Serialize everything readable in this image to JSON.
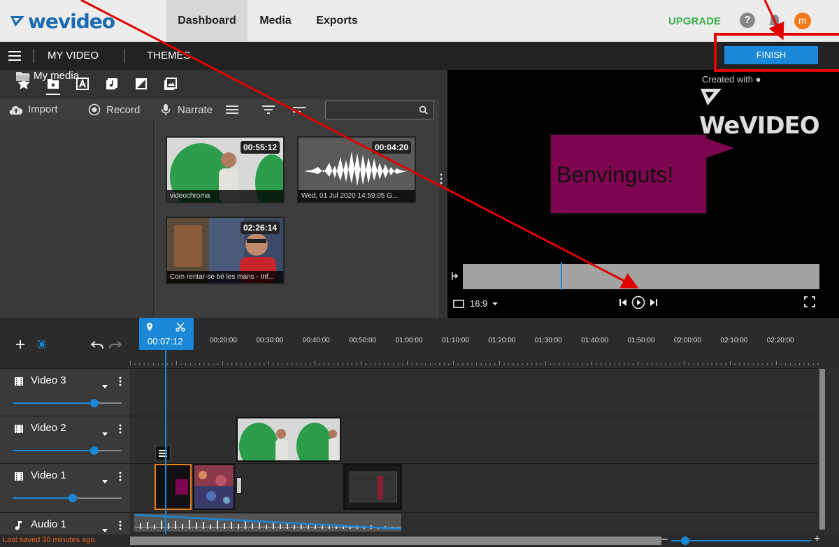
{
  "brand": {
    "name": "wevideo",
    "accent": "#1a87d8",
    "upgrade_color": "#3cb04a"
  },
  "topnav": {
    "tabs": [
      {
        "label": "Dashboard",
        "active": true
      },
      {
        "label": "Media",
        "active": false
      },
      {
        "label": "Exports",
        "active": false
      }
    ],
    "upgrade_label": "UPGRADE",
    "help_glyph": "?",
    "avatar_initial": "m"
  },
  "editor_bar": {
    "project_title": "MY VIDEO",
    "themes_label": "THEMES",
    "finish_label": "FINISH"
  },
  "media_panel": {
    "icons": [
      "star-icon",
      "media-folder-icon",
      "text-icon",
      "music-icon",
      "transition-icon",
      "image-icon"
    ],
    "tools": [
      {
        "label": "Import",
        "icon": "cloud-upload-icon"
      },
      {
        "label": "Record",
        "icon": "record-icon"
      },
      {
        "label": "Narrate",
        "icon": "microphone-icon"
      }
    ],
    "search_placeholder": "",
    "folder_label": "My media",
    "items": [
      {
        "caption": "videochroma",
        "duration": "00:55:12",
        "kind": "video"
      },
      {
        "caption": "Wed, 01 Jul 2020 14:59:05 G...",
        "duration": "00:04:20",
        "kind": "audio"
      },
      {
        "caption": "Com rentar-se bé les mans - Inf...",
        "duration": "02:26:14",
        "kind": "video"
      }
    ]
  },
  "preview": {
    "watermark_created": "Created with",
    "watermark_brand": "WeVIDEO",
    "bubble_text": "Benvinguts!",
    "bubble_color": "#800550",
    "aspect_label": "16:9",
    "scrub_progress": 0.275
  },
  "timeline": {
    "playhead_time": "00:07:12",
    "ruler_ticks": [
      "00:20:00",
      "00:30:00",
      "00:40:00",
      "00:50:00",
      "01:00:00",
      "01:10:00",
      "01:20:00",
      "01:30:00",
      "01:40:00",
      "01:50:00",
      "02:00:00",
      "02:10:00",
      "02:20:00"
    ],
    "tracks": [
      {
        "name": "Video 3",
        "type": "video",
        "volume": 0.75
      },
      {
        "name": "Video 2",
        "type": "video",
        "volume": 0.75
      },
      {
        "name": "Video 1",
        "type": "video",
        "volume": 0.55
      },
      {
        "name": "Audio 1",
        "type": "audio",
        "volume": 1.0
      }
    ],
    "zoom_level": 0.1
  },
  "status": {
    "saved_text": "Last saved 30 minutes ago."
  }
}
